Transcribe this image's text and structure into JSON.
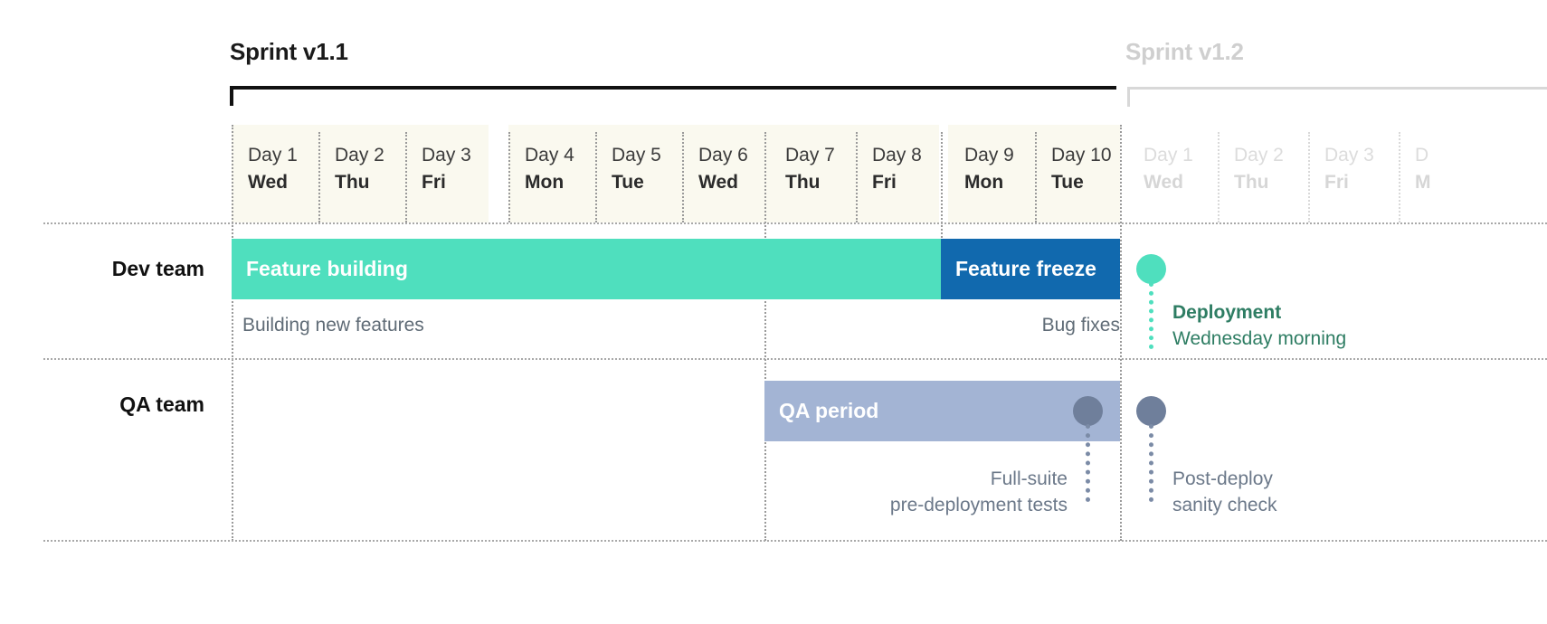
{
  "sprints": [
    {
      "title": "Sprint v1.1",
      "muted": false
    },
    {
      "title": "Sprint v1.2",
      "muted": true
    }
  ],
  "days_sprint1": [
    {
      "num": "Day 1",
      "day": "Wed"
    },
    {
      "num": "Day 2",
      "day": "Thu"
    },
    {
      "num": "Day 3",
      "day": "Fri"
    },
    {
      "num": "Day 4",
      "day": "Mon"
    },
    {
      "num": "Day 5",
      "day": "Tue"
    },
    {
      "num": "Day 6",
      "day": "Wed"
    },
    {
      "num": "Day 7",
      "day": "Thu"
    },
    {
      "num": "Day 8",
      "day": "Fri"
    },
    {
      "num": "Day 9",
      "day": "Mon"
    },
    {
      "num": "Day 10",
      "day": "Tue"
    }
  ],
  "days_sprint2": [
    {
      "num": "Day 1",
      "day": "Wed"
    },
    {
      "num": "Day 2",
      "day": "Thu"
    },
    {
      "num": "Day 3",
      "day": "Fri"
    },
    {
      "num": "D",
      "day": "M"
    }
  ],
  "rows": [
    {
      "label": "Dev team"
    },
    {
      "label": "QA team"
    }
  ],
  "bars": [
    {
      "label": "Feature building",
      "color": "#4FDFBE"
    },
    {
      "label": "Feature freeze",
      "color": "#1169AE"
    },
    {
      "label": "QA period",
      "color": "#A3B4D4"
    }
  ],
  "sublabels": [
    {
      "text": "Building new features"
    },
    {
      "text": "Bug fixes"
    }
  ],
  "milestones": [
    {
      "name": "deployment",
      "line1": "Deployment",
      "line2": "Wednesday morning",
      "dot_color": "#4FDFBE",
      "text_color": "#2e7d63"
    },
    {
      "name": "full-suite-tests",
      "line1": "Full-suite",
      "line2": "pre-deployment tests",
      "dot_color": "#6F7F9B",
      "text_color": "#6b7889"
    },
    {
      "name": "post-deploy-sanity",
      "line1": "Post-deploy",
      "line2": "sanity check",
      "dot_color": "#6F7F9B",
      "text_color": "#6b7889"
    }
  ],
  "colors": {
    "day_header_bg": "#faf9ef",
    "teal": "#4FDFBE",
    "blue": "#1169AE",
    "periwinkle": "#A3B4D4",
    "slate": "#6F7F9B",
    "deploy_green": "#2e7d63",
    "muted_text": "#d6d6d6"
  }
}
